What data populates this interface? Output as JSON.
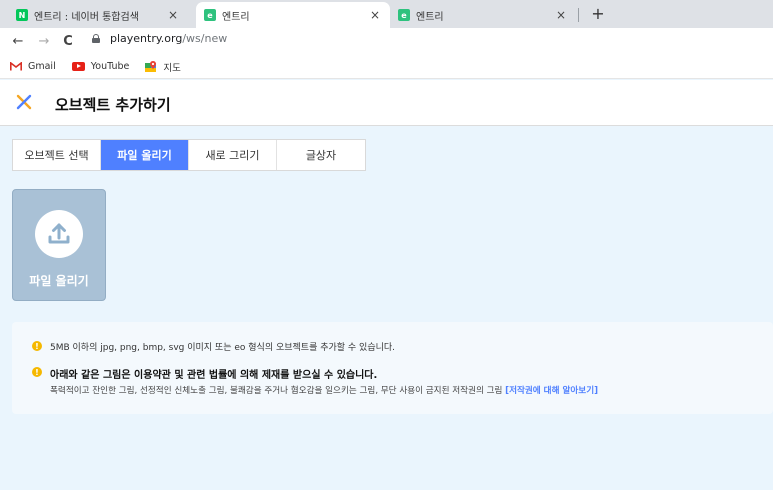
{
  "browser": {
    "tabs": [
      {
        "title": "엔트리 : 네이버 통합검색",
        "favicon_text": "N",
        "favicon_color": "#03c75a",
        "active": false
      },
      {
        "title": "엔트리",
        "favicon_text": "e",
        "favicon_color": "#2ec27e",
        "active": true
      },
      {
        "title": "엔트리",
        "favicon_text": "e",
        "favicon_color": "#2ec27e",
        "active": false
      }
    ],
    "tab_close_glyph": "×",
    "new_tab_glyph": "+",
    "nav": {
      "back": "←",
      "forward": "→",
      "reload": "C"
    },
    "url_host": "playentry.org",
    "url_path": "/ws/new",
    "bookmarks": [
      {
        "label": "Gmail",
        "icon": "gmail-icon"
      },
      {
        "label": "YouTube",
        "icon": "youtube-icon"
      },
      {
        "label": "지도",
        "icon": "maps-icon"
      }
    ]
  },
  "header": {
    "title": "오브젝트 추가하기",
    "close_icon": "close-icon",
    "close_color": "#f5a623"
  },
  "object_tabs": [
    {
      "label": "오브젝트 선택",
      "active": false
    },
    {
      "label": "파일 올리기",
      "active": true
    },
    {
      "label": "새로 그리기",
      "active": false
    },
    {
      "label": "글상자",
      "active": false
    }
  ],
  "upload": {
    "label": "파일 올리기",
    "icon": "upload-icon"
  },
  "notice": {
    "icon_glyph": "!",
    "line1": "5MB 이하의 jpg, png, bmp, svg 이미지 또는 eo 형식의 오브젝트를 추가할 수 있습니다.",
    "line2": "아래와 같은 그림은 이용약관 및 관련 법률에 의해 제재를 받으실 수 있습니다.",
    "line3": "폭력적이고 잔인한 그림, 선정적인 신체노출 그림, 불쾌감을 주거나 혐오감을 일으키는 그림, 무단 사용이 금지된 저작권의 그림",
    "link": "[저작권에 대해 알아보기]"
  },
  "colors": {
    "accent": "#4f80ff",
    "page_bg": "#eaf5fd",
    "upload_tile": "#a9c1d6",
    "warning": "#f5b800"
  }
}
